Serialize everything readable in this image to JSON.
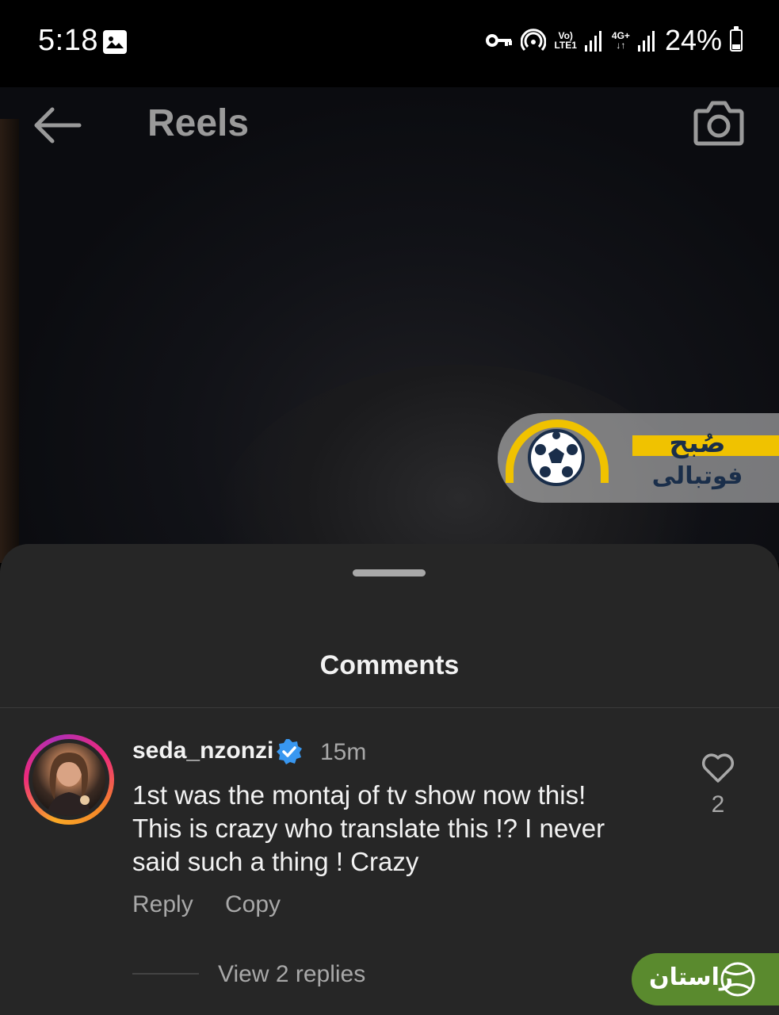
{
  "status_bar": {
    "time": "5:18",
    "network_label_1_top": "Vo)",
    "network_label_1_bottom": "LTE1",
    "network_label_2_top": "4G+",
    "network_label_2_bottom": "↓↑",
    "battery": "24%",
    "icons": [
      "image-icon",
      "key-icon",
      "hotspot-icon",
      "signal-icon",
      "battery-icon"
    ]
  },
  "header": {
    "title": "Reels",
    "icons": [
      "back-arrow-icon",
      "camera-icon"
    ]
  },
  "watermark": {
    "line1": "صُبح",
    "line2": "فوتبالی",
    "colors": {
      "yellow": "#f0c200",
      "navy": "#1a2e4a"
    }
  },
  "comments_sheet": {
    "title": "Comments",
    "comments": [
      {
        "username": "seda_nzonzi",
        "verified": true,
        "time": "15m",
        "text_lines": [
          "1st was the montaj of tv show now this!",
          "This is crazy who translate this !? I never",
          "said such a thing ! Crazy"
        ],
        "reply_label": "Reply",
        "copy_label": "Copy",
        "like_count": "2",
        "view_replies_label": "View 2 replies"
      }
    ]
  },
  "corner_watermark": {
    "text": "راستان",
    "color": "#5a8a2e"
  }
}
